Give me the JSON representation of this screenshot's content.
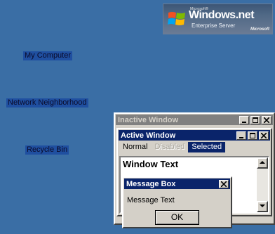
{
  "desktop": {
    "icons": [
      {
        "label": "My Computer"
      },
      {
        "label": "Network Neighborhood"
      },
      {
        "label": "Recycle Bin"
      }
    ],
    "background": "#3a6ea5"
  },
  "logo": {
    "trademark": "Microsoft®",
    "product": "Windows.net",
    "edition": "Enterprise Server",
    "brand": "Microsoft"
  },
  "inactive_window": {
    "title": "Inactive Window"
  },
  "active_window": {
    "title": "Active Window",
    "menu": [
      {
        "label": "Normal",
        "state": "normal"
      },
      {
        "label": "Disabled",
        "state": "disabled"
      },
      {
        "label": "Selected",
        "state": "selected"
      }
    ],
    "client_text": "Window Text"
  },
  "message_box": {
    "title": "Message Box",
    "text": "Message Text",
    "ok_label": "OK"
  },
  "colors": {
    "active_title": "#0a246a",
    "inactive_title": "#808080",
    "face": "#d4d0c8"
  }
}
